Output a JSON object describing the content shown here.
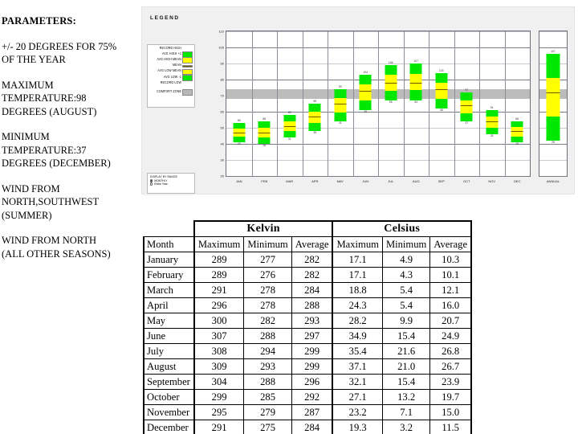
{
  "parameters": {
    "heading": "PARAMETERS:",
    "blocks": [
      [
        "+/- 20 DEGREES FOR 75%",
        "OF THE YEAR"
      ],
      [
        "MAXIMUM",
        "TEMPERATURE:98",
        "DEGREES (AUGUST)"
      ],
      [
        "MINIMUM",
        "TEMPERATURE:37",
        "DEGREES (DECEMBER)"
      ],
      [
        "WIND FROM",
        "NORTH,SOUTHWEST",
        "(SUMMER)"
      ],
      [
        "WIND FROM NORTH",
        "(ALL OTHER SEASONS)"
      ]
    ]
  },
  "legend": {
    "title": "LEGEND",
    "items": [
      {
        "label": "RECORD HIGH",
        "swatch": "none"
      },
      {
        "label": "AVG HIGH +1",
        "swatch": "#00e800"
      },
      {
        "label": "AVG HIGH MEAN",
        "swatch": "#ffff00"
      },
      {
        "label": "MEAN",
        "swatch": "#6b5a00"
      },
      {
        "label": "AVG LOW MEAN",
        "swatch": "#ffff00"
      },
      {
        "label": "AVG LOW -1",
        "swatch": "#00e800"
      },
      {
        "label": "RECORD LOW",
        "swatch": "none"
      },
      {
        "label": "COMFORT ZONE",
        "swatch": "#b8b8b8"
      }
    ],
    "display_by": {
      "title": "DISPLAY BY RANGE",
      "options": [
        {
          "label": "MONTHLY",
          "selected": true
        },
        {
          "label": "Entire Year",
          "selected": false
        }
      ]
    }
  },
  "chart_data": {
    "type": "bar",
    "title": "",
    "xlabel": "",
    "ylabel": "",
    "ylim": [
      20,
      110
    ],
    "yticks": [
      20,
      30,
      40,
      50,
      60,
      70,
      80,
      90,
      100,
      110
    ],
    "grid": true,
    "legend_position": "left",
    "comfort_zone": [
      68,
      74
    ],
    "categories": [
      "JAN",
      "FEB",
      "MAR",
      "APR",
      "MAY",
      "JUN",
      "JUL",
      "AUG",
      "SEP",
      "OCT",
      "NOV",
      "DEC"
    ],
    "annual_category": "ANNUAL",
    "series": [
      {
        "name": "RECORD HIGH",
        "values": [
          85,
          86,
          89,
          95,
          99,
          104,
          106,
          107,
          103,
          97,
          91,
          86
        ],
        "annual": 107
      },
      {
        "name": "AVG HIGH",
        "values": [
          53,
          54,
          58,
          65,
          74,
          83,
          89,
          90,
          84,
          72,
          61,
          54
        ],
        "annual": 96
      },
      {
        "name": "MEAN",
        "values": [
          47,
          47,
          51,
          57,
          65,
          73,
          78,
          78,
          74,
          64,
          54,
          48
        ],
        "annual": 72
      },
      {
        "name": "AVG LOW",
        "values": [
          41,
          40,
          44,
          48,
          54,
          61,
          67,
          67,
          62,
          54,
          46,
          41
        ],
        "annual": 42
      },
      {
        "name": "RECORD LOW",
        "values": [
          29,
          28,
          31,
          35,
          41,
          48,
          55,
          54,
          48,
          37,
          31,
          28
        ],
        "annual": 28
      }
    ]
  },
  "table": {
    "group_headers": [
      {
        "label": "",
        "span": 1
      },
      {
        "label": "Kelvin",
        "span": 3
      },
      {
        "label": "Celsius",
        "span": 3
      }
    ],
    "columns": [
      "Month",
      "Maximum",
      "Minimum",
      "Average",
      "Maximum",
      "Minimum",
      "Average"
    ],
    "rows": [
      [
        "January",
        "289",
        "277",
        "282",
        "17.1",
        "4.9",
        "10.3"
      ],
      [
        "February",
        "289",
        "276",
        "282",
        "17.1",
        "4.3",
        "10.1"
      ],
      [
        "March",
        "291",
        "278",
        "284",
        "18.8",
        "5.4",
        "12.1"
      ],
      [
        "April",
        "296",
        "278",
        "288",
        "24.3",
        "5.4",
        "16.0"
      ],
      [
        "May",
        "300",
        "282",
        "293",
        "28.2",
        "9.9",
        "20.7"
      ],
      [
        "June",
        "307",
        "288",
        "297",
        "34.9",
        "15.4",
        "24.9"
      ],
      [
        "July",
        "308",
        "294",
        "299",
        "35.4",
        "21.6",
        "26.8"
      ],
      [
        "August",
        "309",
        "293",
        "299",
        "37.1",
        "21.0",
        "26.7"
      ],
      [
        "September",
        "304",
        "288",
        "296",
        "32.1",
        "15.4",
        "23.9"
      ],
      [
        "October",
        "299",
        "285",
        "292",
        "27.1",
        "13.2",
        "19.7"
      ],
      [
        "November",
        "295",
        "279",
        "287",
        "23.2",
        "7.1",
        "15.0"
      ],
      [
        "December",
        "291",
        "275",
        "284",
        "19.3",
        "3.2",
        "11.5"
      ]
    ]
  },
  "colors": {
    "bar_outer": "#00e800",
    "bar_inner": "#ffff00",
    "mean_line": "#6b5a00",
    "comfort_band": "#b8b8b8",
    "panel_bg": "#f0f0f0",
    "plot_bg": "#ffffff"
  }
}
